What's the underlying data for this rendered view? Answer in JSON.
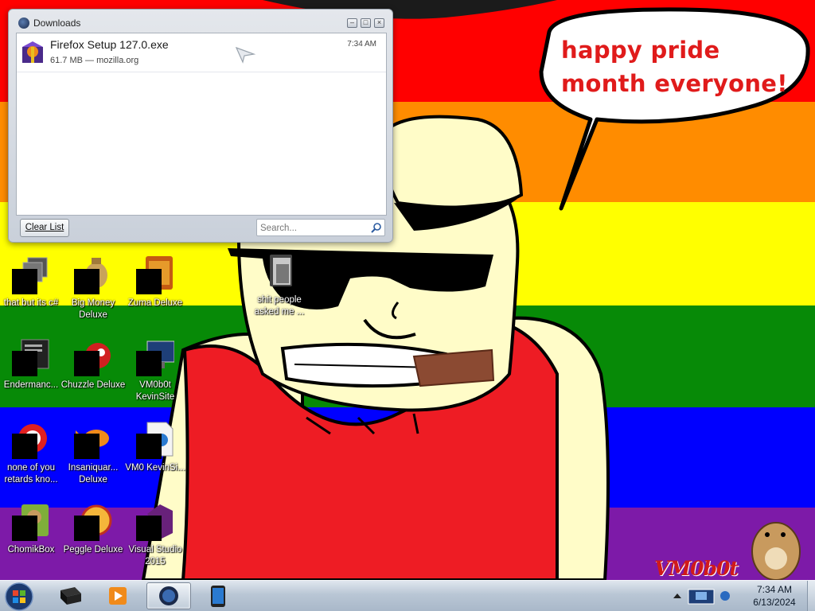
{
  "wallpaper": {
    "bubble_text": "happy pride month everyone!",
    "signature": "VM0b0t",
    "stripe_colors": [
      "#ff0000",
      "#ff8c00",
      "#ffff00",
      "#008800",
      "#0000ff",
      "#7b1aa7"
    ]
  },
  "desktop_icons": [
    {
      "label": "that but its c#"
    },
    {
      "label": "Big Money Deluxe"
    },
    {
      "label": "Zuma Deluxe"
    },
    {
      "label": "shit people asked me ..."
    },
    {
      "label": "Endermanc..."
    },
    {
      "label": "Chuzzle Deluxe"
    },
    {
      "label": "VM0b0t KevinSite"
    },
    {
      "label": "none of you retards kno..."
    },
    {
      "label": "Insaniquar... Deluxe"
    },
    {
      "label": "VM0 KevinSi..."
    },
    {
      "label": "ChomikBox"
    },
    {
      "label": "Peggle Deluxe"
    },
    {
      "label": "Visual Studio 2015"
    }
  ],
  "downloads_window": {
    "title": "Downloads",
    "items": [
      {
        "name": "Firefox Setup 127.0.exe",
        "meta": "61.7 MB — mozilla.org",
        "time": "7:34 AM"
      }
    ],
    "clear_button": "Clear List",
    "search_placeholder": "Search..."
  },
  "taskbar": {
    "apps": [
      "terminal",
      "media-player",
      "firefox",
      "device-app"
    ],
    "active_app": "firefox",
    "clock_time": "7:34 AM",
    "clock_date": "6/13/2024"
  },
  "colors": {
    "accent": "#1e3f78",
    "bubble_text": "#e01b1b",
    "taskbar": "#b9c6d5"
  }
}
